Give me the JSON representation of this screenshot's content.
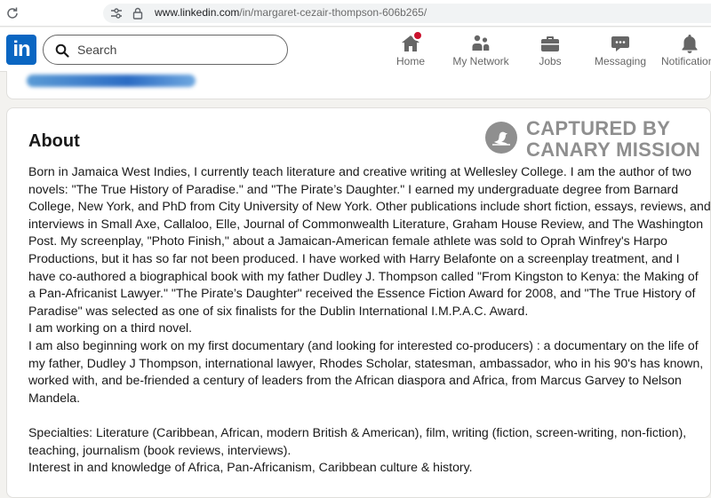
{
  "browser": {
    "url_domain": "www.linkedin.com",
    "url_path": "/in/margaret-cezair-thompson-606b265/"
  },
  "nav": {
    "logo": "in",
    "search_placeholder": "Search",
    "items": [
      {
        "label": "Home",
        "icon": "home-icon"
      },
      {
        "label": "My Network",
        "icon": "network-icon"
      },
      {
        "label": "Jobs",
        "icon": "briefcase-icon"
      },
      {
        "label": "Messaging",
        "icon": "chat-icon"
      },
      {
        "label": "Notifications",
        "icon": "bell-icon"
      }
    ],
    "badge_color": "#cb112d",
    "brand_color": "#0a66c2"
  },
  "about": {
    "title": "About",
    "lines": [
      "Born in Jamaica West Indies, I currently teach literature and creative writing at Wellesley College. I am the author of two",
      "novels: \"The True History of Paradise.\" and \"The Pirate’s Daughter.\" I earned my undergraduate degree from Barnard",
      "College, New York, and PhD from City University of New York. Other publications include short fiction, essays, reviews, and",
      "interviews in Small Axe, Callaloo, Elle, Journal of Commonwealth Literature, Graham House Review, and The Washington",
      "Post. My screenplay, \"Photo Finish,\" about a Jamaican-American female athlete was sold to Oprah Winfrey's Harpo",
      "Productions, but it has so far not been produced. I have worked with Harry Belafonte on a screenplay treatment, and I",
      "have co-authored a biographical book with my father Dudley J. Thompson called \"From Kingston to Kenya: the Making of",
      "a Pan-Africanist Lawyer.\" \"The Pirate’s Daughter\" received the Essence Fiction Award for 2008, and \"The True History of",
      "Paradise\" was selected as one of six finalists for the Dublin International I.M.P.A.C. Award.",
      "I am working on a third novel.",
      "I am also beginning work on my first documentary (and looking for interested co-producers) : a documentary on the life of",
      "my father, Dudley J Thompson, international lawyer, Rhodes Scholar, statesman, ambassador, who in his 90's has known,",
      "worked with, and be-friended a century of leaders from the African diaspora and Africa, from Marcus Garvey to Nelson",
      "Mandela."
    ],
    "specialties_lines": [
      "Specialties: Literature (Caribbean, African, modern British & American), film, writing (fiction, screen-writing, non-fiction),",
      "teaching, journalism (book reviews, interviews).",
      "Interest in and knowledge of Africa, Pan-Africanism, Caribbean culture & history."
    ]
  },
  "watermark": {
    "line1": "CAPTURED BY",
    "line2": "CANARY MISSION"
  }
}
